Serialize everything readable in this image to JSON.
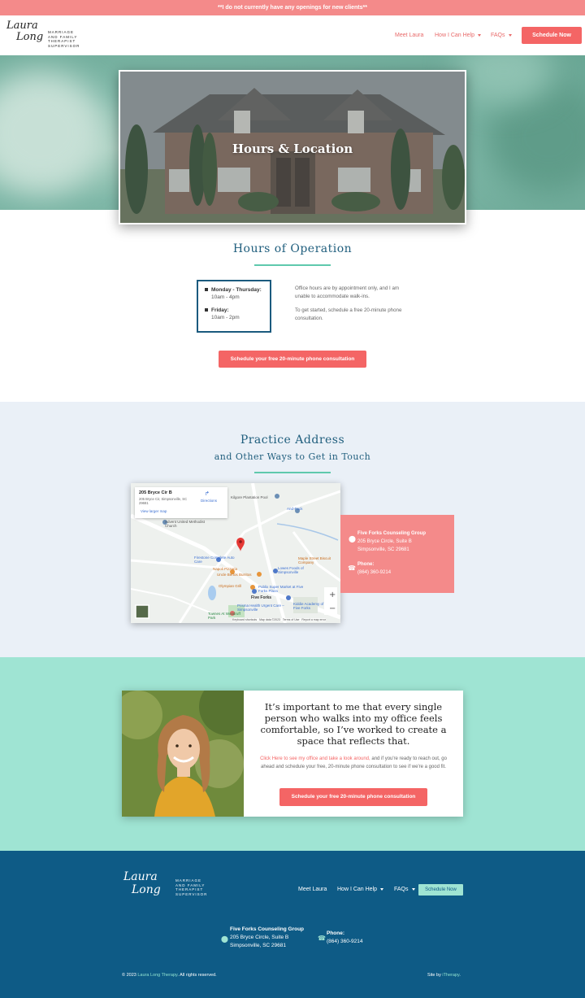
{
  "banner": {
    "text": "**I do not currently have any openings for new clients**"
  },
  "logo": {
    "line1": "Laura",
    "line2": "Long",
    "sub1": "MARRIAGE",
    "sub2": "AND FAMILY",
    "sub3": "THERAPIST",
    "sub4": "SUPERVISOR"
  },
  "nav": {
    "items": [
      {
        "label": "Meet Laura"
      },
      {
        "label": "How I Can Help"
      },
      {
        "label": "FAQs"
      }
    ],
    "cta": "Schedule Now"
  },
  "hero": {
    "title": "Hours & Location"
  },
  "hours": {
    "heading": "Hours of Operation",
    "slots": [
      {
        "day": "Monday - Thursday:",
        "time": "10am - 4pm"
      },
      {
        "day": "Friday:",
        "time": "10am - 2pm"
      }
    ],
    "note1": "Office hours are by appointment only, and I am unable to accommodate walk-ins.",
    "note2": "To get started, schedule a free 20-minute phone consultation.",
    "cta": "Schedule your free 20-minute phone consultation"
  },
  "address": {
    "heading": "Practice Address",
    "subheading": "and Other Ways to Get in Touch",
    "map": {
      "place_title": "205 Bryce Cir B",
      "place_addr": "205 Bryce Cir, Simpsonville, SC 29681",
      "directions": "Directions",
      "larger": "View larger map",
      "labels": [
        "Kilgore Plantation Pool",
        "And-Pack",
        "Advent United Methodist Church",
        "Firestone Complete Auto Care",
        "Napoli Pizzeria",
        "Uncle Bertos Burritos",
        "Maple Street Biscuit Company",
        "Lowes Foods of Simpsonville",
        "Olympian Grill",
        "Publix Super Market at Five Forks Plaza",
        "Five Forks",
        "Prisma Health Urgent Care – Simpsonville",
        "Kiddie Academy of Five Forks",
        "Townes At Woodruff Park"
      ],
      "footer": "Keyboard shortcuts   Map data ©2023   Terms of Use   Report a map error"
    },
    "contact": {
      "org": "Five Forks Counseling Group",
      "street": "205 Bryce Circle, Suite B",
      "city": "Simpsonville, SC 29681",
      "phone_label": "Phone:",
      "phone": "(864) 360-9214"
    }
  },
  "story": {
    "quote": "It’s important to me that every single person who walks into my office feels comfortable, so I’ve worked to create a space that reflects that.",
    "link": "Click Here to see my office and take a look around,",
    "text": " and if you're ready to reach out, go ahead and schedule your free, 20-minute phone consultation to see if we're a good fit.",
    "cta": "Schedule your free 20-minute phone consultation"
  },
  "footer": {
    "nav": [
      {
        "label": "Meet Laura"
      },
      {
        "label": "How I Can Help"
      },
      {
        "label": "FAQs"
      }
    ],
    "cta": "Schedule Now",
    "org": "Five Forks Counseling Group",
    "street": "205 Bryce Circle, Suite B",
    "city": "Simpsonville, SC 29681",
    "phone_label": "Phone:",
    "phone": "(864) 360-9214",
    "copyright_prefix": "© 2023 ",
    "copyright_link": "Laura Long Therapy",
    "copyright_suffix": ". All rights reserved.",
    "site_by_prefix": "Site by ",
    "site_by_link": "iTherapy",
    "site_by_suffix": "."
  },
  "colors": {
    "coral": "#f46565",
    "banner": "#f48a8a",
    "navy": "#0e5b86",
    "teal": "#9fe4d3",
    "heading": "#215f7e"
  }
}
